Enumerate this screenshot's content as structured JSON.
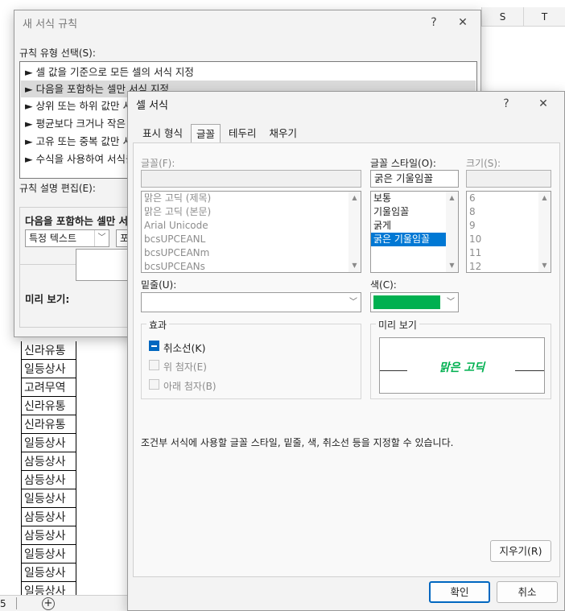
{
  "spreadsheet": {
    "columns": [
      "S",
      "T"
    ],
    "rows": [
      "신라유통",
      "일등상사",
      "고려무역",
      "신라유통",
      "신라유통",
      "일등상사",
      "삼등상사",
      "삼등상사",
      "일등상사",
      "삼등상사",
      "삼등상사",
      "일등상사",
      "일등상사",
      "일등상사"
    ],
    "sheet_tab_number": "5",
    "add_sheet_glyph": "+"
  },
  "rule_dialog": {
    "title": "새 서식 규칙",
    "help_glyph": "?",
    "close_glyph": "✕",
    "rule_type_label": "규칙 유형 선택(S):",
    "rule_types": [
      "► 셀 값을 기준으로 모든 셀의 서식 지정",
      "► 다음을 포함하는 셀만 서식 지정",
      "► 상위 또는 하위 값만 서식 지정",
      "► 평균보다 크거나 작은 값만 서식 지정",
      "► 고유 또는 중복 값만 서식 지정",
      "► 수식을 사용하여 서식을 지정할 셀 결정"
    ],
    "selected_rule_index": 1,
    "edit_label": "규칙 설명 편집(E):",
    "edit_heading": "다음을 포함하는 셀만 서식 지정",
    "condition_select": "특정 텍스트",
    "condition_select2": "포",
    "preview_label": "미리 보기:"
  },
  "format_dialog": {
    "title": "셀 서식",
    "help_glyph": "?",
    "close_glyph": "✕",
    "tabs": [
      "표시 형식",
      "글꼴",
      "테두리",
      "채우기"
    ],
    "active_tab": "글꼴",
    "font_label": "글꼴(F):",
    "font_value": "",
    "font_list": [
      "맑은 고딕 (제목)",
      "맑은 고딕 (본문)",
      "Arial Unicode",
      "bcsUPCEANL",
      "bcsUPCEANm",
      "bcsUPCEANs"
    ],
    "style_label": "글꼴 스타일(O):",
    "style_value": "굵은 기울임꼴",
    "style_list": [
      "보통",
      "기울임꼴",
      "굵게",
      "굵은 기울임꼴"
    ],
    "style_selected_index": 3,
    "size_label": "크기(S):",
    "size_value": "",
    "size_list": [
      "6",
      "8",
      "9",
      "10",
      "11",
      "12"
    ],
    "underline_label": "밑줄(U):",
    "underline_value": "",
    "color_label": "색(C):",
    "color_value": "#00b050",
    "effects_label": "효과",
    "effects": [
      {
        "label": "취소선(K)",
        "checked": true,
        "enabled": true
      },
      {
        "label": "위 첨자(E)",
        "checked": false,
        "enabled": false
      },
      {
        "label": "아래 첨자(B)",
        "checked": false,
        "enabled": false
      }
    ],
    "preview_label": "미리 보기",
    "preview_text": "맑은 고딕",
    "description": "조건부 서식에 사용할 글꼴 스타일, 밑줄, 색, 취소선 등을 지정할 수 있습니다.",
    "clear_button": "지우기(R)",
    "ok_button": "확인",
    "cancel_button": "취소"
  }
}
